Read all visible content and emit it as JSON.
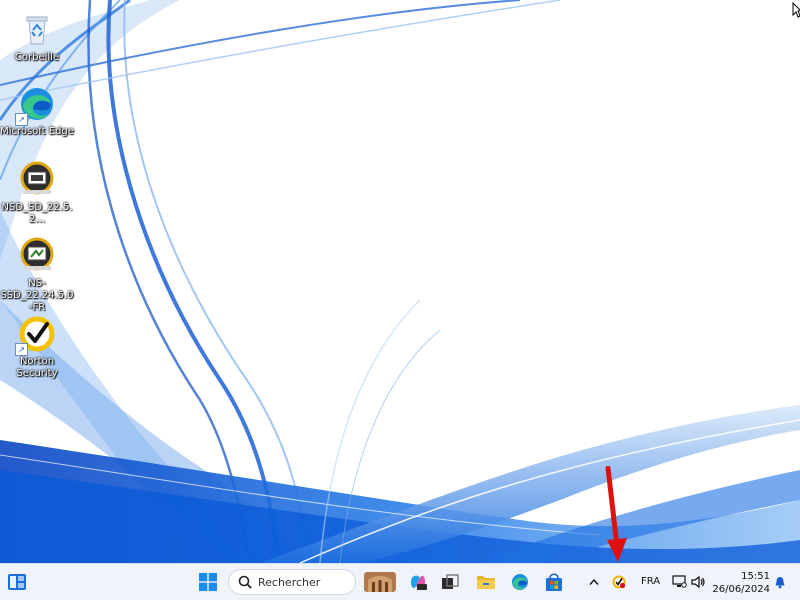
{
  "desktop": {
    "icons": [
      {
        "label": "Corbeille",
        "icon": "recycle-bin-icon"
      },
      {
        "label": "Microsoft Edge",
        "icon": "edge-icon"
      },
      {
        "label": "NSD_SD_22.5.2...",
        "icon": "nsd-installer-icon"
      },
      {
        "label": "NS-SSD_22.24.5.0-FR",
        "icon": "ns-ssd-installer-icon"
      },
      {
        "label": "Norton Security",
        "icon": "norton-icon"
      }
    ]
  },
  "taskbar": {
    "search_placeholder": "Rechercher",
    "apps": [
      "start-icon",
      "search-icon",
      "news-widget-icon",
      "copilot-icon",
      "task-view-icon",
      "file-explorer-icon",
      "edge-icon",
      "store-icon"
    ],
    "tray": {
      "language": "FRA",
      "time": "15:51",
      "date": "26/06/2024"
    }
  },
  "colors": {
    "taskbar_bg": "#f0f3f9",
    "wallpaper_blue": "#0a5ad8",
    "annotation_arrow": "#e01010"
  }
}
